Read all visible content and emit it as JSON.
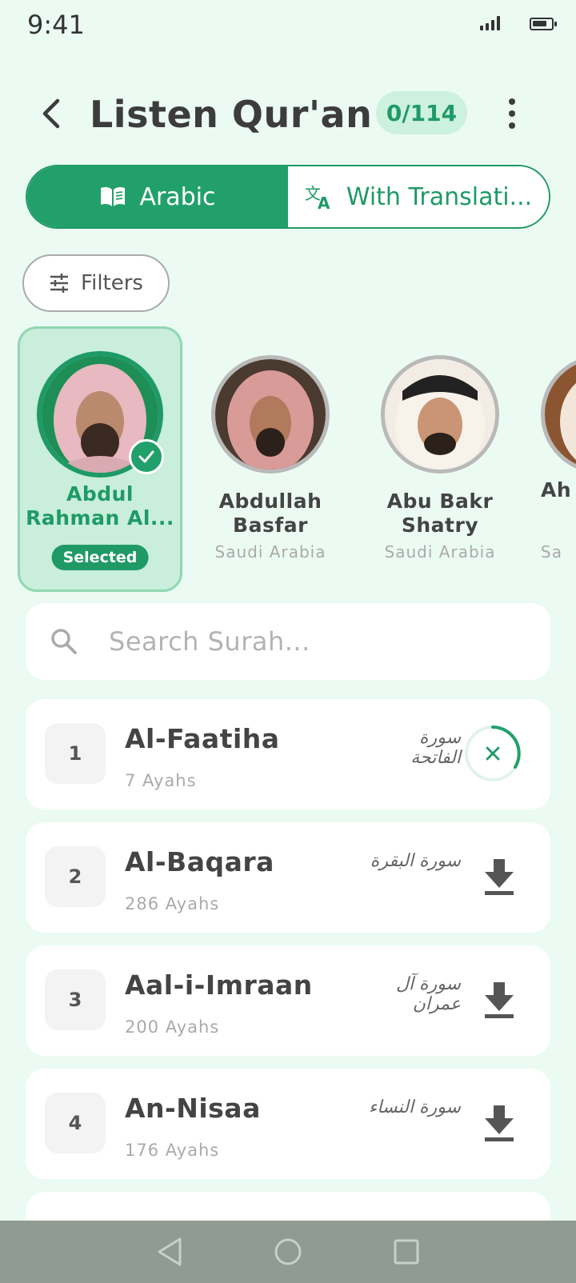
{
  "status_bar": {
    "time": "9:41"
  },
  "header": {
    "title": "Listen Qur'an",
    "counter": "0/114"
  },
  "toggle": {
    "arabic_label": "Arabic",
    "translation_label": "With Translati..."
  },
  "filters": {
    "label": "Filters"
  },
  "reciters": [
    {
      "name_line1": "Abdul",
      "name_line2": "Rahman Al...",
      "badge": "Selected",
      "selected": true
    },
    {
      "name_line1": "Abdullah",
      "name_line2": "Basfar",
      "country": "Saudi Arabia",
      "selected": false
    },
    {
      "name_line1": "Abu Bakr",
      "name_line2": "Shatry",
      "country": "Saudi Arabia",
      "selected": false
    },
    {
      "name_line1": "Ah",
      "country": "Sa",
      "selected": false
    }
  ],
  "search": {
    "placeholder": "Search Surah..."
  },
  "surahs": [
    {
      "number": "1",
      "name": "Al-Faatiha",
      "ayahs": "7 Ayahs",
      "arabic": "سورة الفاتحة",
      "state": "downloading"
    },
    {
      "number": "2",
      "name": "Al-Baqara",
      "ayahs": "286 Ayahs",
      "arabic": "سورة البقرة",
      "state": "download"
    },
    {
      "number": "3",
      "name": "Aal-i-Imraan",
      "ayahs": "200 Ayahs",
      "arabic": "سورة آل عمران",
      "state": "download"
    },
    {
      "number": "4",
      "name": "An-Nisaa",
      "ayahs": "176 Ayahs",
      "arabic": "سورة النساء",
      "state": "download"
    }
  ],
  "colors": {
    "accent": "#22a06b",
    "accent_dark": "#1f9a66",
    "background": "#ebfbf3"
  }
}
